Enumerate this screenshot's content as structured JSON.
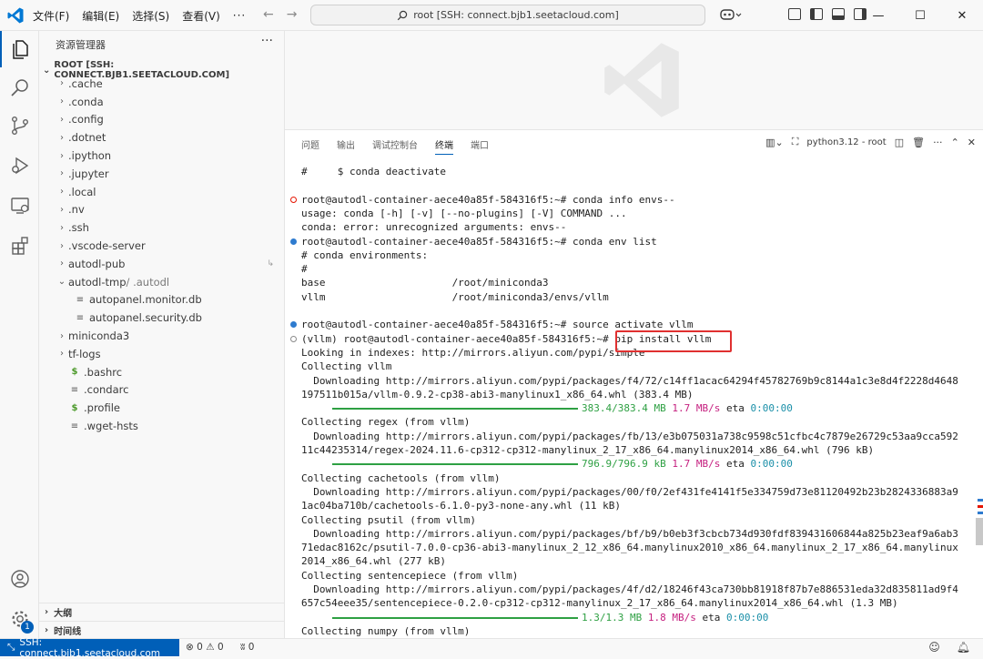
{
  "titlebar": {
    "menu": [
      "文件(F)",
      "编辑(E)",
      "选择(S)",
      "查看(V)",
      "···"
    ],
    "search_text": "root [SSH: connect.bjb1.seetacloud.com]"
  },
  "sidebar": {
    "title": "资源管理器",
    "root_label": "ROOT [SSH: CONNECT.BJB1.SEETACLOUD.COM]",
    "items": [
      {
        "name": ".cache",
        "kind": "folder"
      },
      {
        "name": ".conda",
        "kind": "folder"
      },
      {
        "name": ".config",
        "kind": "folder"
      },
      {
        "name": ".dotnet",
        "kind": "folder"
      },
      {
        "name": ".ipython",
        "kind": "folder"
      },
      {
        "name": ".jupyter",
        "kind": "folder"
      },
      {
        "name": ".local",
        "kind": "folder"
      },
      {
        "name": ".nv",
        "kind": "folder"
      },
      {
        "name": ".ssh",
        "kind": "folder"
      },
      {
        "name": ".vscode-server",
        "kind": "folder"
      },
      {
        "name": "autodl-pub",
        "kind": "folder"
      },
      {
        "name": "autodl-tmp",
        "kind": "folder-open",
        "suffix": " / .autodl"
      },
      {
        "name": "autopanel.monitor.db",
        "kind": "file"
      },
      {
        "name": "autopanel.security.db",
        "kind": "file"
      },
      {
        "name": "miniconda3",
        "kind": "folder"
      },
      {
        "name": "tf-logs",
        "kind": "folder"
      },
      {
        "name": ".bashrc",
        "kind": "shell"
      },
      {
        "name": ".condarc",
        "kind": "file"
      },
      {
        "name": ".profile",
        "kind": "shell"
      },
      {
        "name": ".wget-hsts",
        "kind": "file"
      }
    ],
    "outline_label": "大纲",
    "timeline_label": "时间线"
  },
  "panel": {
    "tabs": [
      "问题",
      "输出",
      "调试控制台",
      "终端",
      "端口"
    ],
    "active_tab": "终端",
    "terminal_name": "python3.12 - root"
  },
  "terminal": {
    "lines": [
      {
        "text": "#     $ conda deactivate"
      },
      {
        "text": ""
      },
      {
        "text": "root@autodl-container-aece40a85f-584316f5:~# conda info envs--",
        "dot": "error"
      },
      {
        "text": "usage: conda [-h] [-v] [--no-plugins] [-V] COMMAND ..."
      },
      {
        "text": "conda: error: unrecognized arguments: envs--"
      },
      {
        "text": "root@autodl-container-aece40a85f-584316f5:~# conda env list",
        "dot": "ok"
      },
      {
        "text": "# conda environments:"
      },
      {
        "text": "#"
      },
      {
        "text": "base                     /root/miniconda3"
      },
      {
        "text": "vllm                     /root/miniconda3/envs/vllm"
      },
      {
        "text": ""
      },
      {
        "text": "root@autodl-container-aece40a85f-584316f5:~# source activate vllm",
        "dot": "ok"
      },
      {
        "text": "(vllm) root@autodl-container-aece40a85f-584316f5:~# pip install vllm",
        "dot": "hollow"
      },
      {
        "text": "Looking in indexes: http://mirrors.aliyun.com/pypi/simple"
      },
      {
        "text": "Collecting vllm"
      },
      {
        "text": "  Downloading http://mirrors.aliyun.com/pypi/packages/f4/72/c14ff1acac64294f45782769b9c8144a1c3e8d4f2228d4648"
      },
      {
        "text": "197511b015a/vllm-0.9.2-cp38-abi3-manylinux1_x86_64.whl (383.4 MB)"
      },
      {
        "progress": true,
        "amount": "383.4/383.4 MB",
        "rate": "1.7 MB/s",
        "eta_label": "eta",
        "eta": "0:00:00"
      },
      {
        "text": "Collecting regex (from vllm)"
      },
      {
        "text": "  Downloading http://mirrors.aliyun.com/pypi/packages/fb/13/e3b075031a738c9598c51cfbc4c7879e26729c53aa9cca592"
      },
      {
        "text": "11c44235314/regex-2024.11.6-cp312-cp312-manylinux_2_17_x86_64.manylinux2014_x86_64.whl (796 kB)"
      },
      {
        "progress": true,
        "amount": "796.9/796.9 kB",
        "rate": "1.7 MB/s",
        "eta_label": "eta",
        "eta": "0:00:00"
      },
      {
        "text": "Collecting cachetools (from vllm)"
      },
      {
        "text": "  Downloading http://mirrors.aliyun.com/pypi/packages/00/f0/2ef431fe4141f5e334759d73e81120492b23b2824336883a9"
      },
      {
        "text": "1ac04ba710b/cachetools-6.1.0-py3-none-any.whl (11 kB)"
      },
      {
        "text": "Collecting psutil (from vllm)"
      },
      {
        "text": "  Downloading http://mirrors.aliyun.com/pypi/packages/bf/b9/b0eb3f3cbcb734d930fdf839431606844a825b23eaf9a6ab3"
      },
      {
        "text": "71edac8162c/psutil-7.0.0-cp36-abi3-manylinux_2_12_x86_64.manylinux2010_x86_64.manylinux_2_17_x86_64.manylinux"
      },
      {
        "text": "2014_x86_64.whl (277 kB)"
      },
      {
        "text": "Collecting sentencepiece (from vllm)"
      },
      {
        "text": "  Downloading http://mirrors.aliyun.com/pypi/packages/4f/d2/18246f43ca730bb81918f87b7e886531eda32d835811ad9f4"
      },
      {
        "text": "657c54eee35/sentencepiece-0.2.0-cp312-cp312-manylinux_2_17_x86_64.manylinux2014_x86_64.whl (1.3 MB)"
      },
      {
        "progress": true,
        "amount": "1.3/1.3 MB",
        "rate": "1.8 MB/s",
        "eta_label": "eta",
        "eta": "0:00:00"
      },
      {
        "text": "Collecting numpy (from vllm)"
      }
    ]
  },
  "statusbar": {
    "remote": "SSH: connect.bjb1.seetacloud.com",
    "errors": "0",
    "warnings": "0",
    "ports": "0"
  },
  "activity_bar": {
    "icons": [
      "files-icon",
      "search-icon",
      "source-control-icon",
      "run-debug-icon",
      "remote-explorer-icon",
      "extensions-icon",
      "account-icon",
      "settings-icon"
    ],
    "settings_badge": "1"
  },
  "colors": {
    "accent": "#005fb8",
    "progress": "#2ea043",
    "rate": "#c51f7f",
    "eta": "#1a8fa8",
    "error_dot": "#e51400",
    "highlight_box": "#e03030"
  }
}
